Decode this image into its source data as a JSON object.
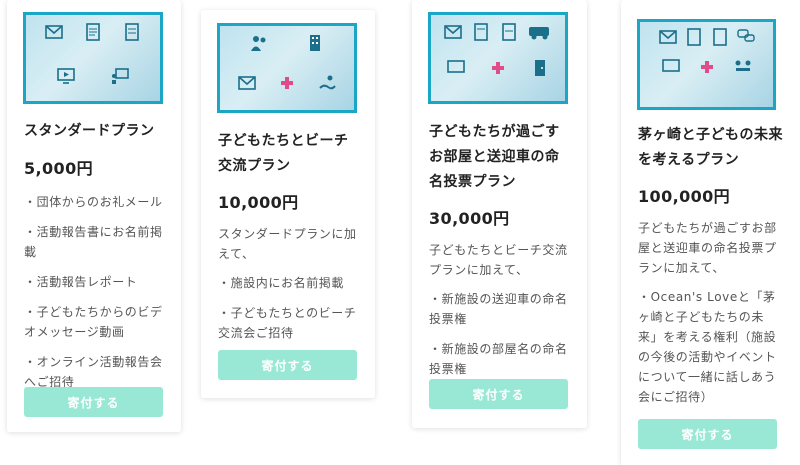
{
  "plans": [
    {
      "title": "スタンダードプラン",
      "price": "5,000円",
      "intro": "",
      "items": [
        "・団体からのお礼メール",
        "・活動報告書にお名前掲載",
        "・活動報告レポート",
        "・子どもたちからのビデオメッセージ動画",
        "・オンライン活動報告会へご招待"
      ],
      "button": "寄付する"
    },
    {
      "title": "子どもたちとビーチ交流プラン",
      "price": "10,000円",
      "intro": "スタンダードプランに加えて、",
      "items": [
        "・施設内にお名前掲載",
        "・子どもたちとのビーチ交流会ご招待"
      ],
      "button": "寄付する"
    },
    {
      "title": "子どもたちが過ごすお部屋と送迎車の命名投票プラン",
      "price": "30,000円",
      "intro": "子どもたちとビーチ交流プランに加えて、",
      "items": [
        "・新施設の送迎車の命名投票権",
        "・新施設の部屋名の命名投票権"
      ],
      "button": "寄付する"
    },
    {
      "title": "茅ヶ崎と子どもの未来を考えるプラン",
      "price": "100,000円",
      "intro": "子どもたちが過ごすお部屋と送迎車の命名投票プランに加えて、",
      "items": [
        "・Ocean's Loveと「茅ヶ崎と子どもたちの未来」を考える権利（施設の今後の活動やイベントについて一緒に話しあう会にご招待）"
      ],
      "button": "寄付する"
    }
  ],
  "colors": {
    "button_bg": "#99e8d6",
    "image_border": "#1aa6c4"
  }
}
